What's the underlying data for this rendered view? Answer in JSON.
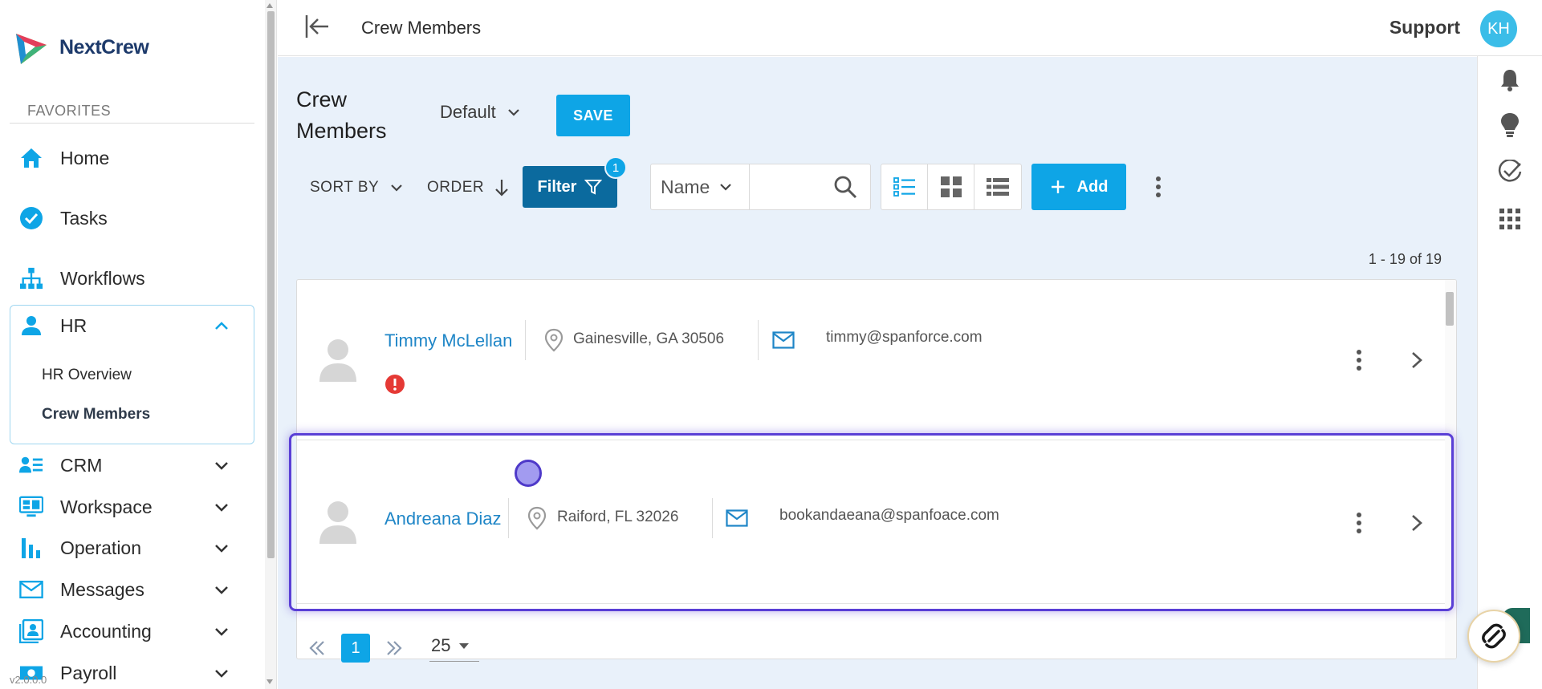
{
  "app": {
    "name": "NextCrew",
    "version": "v2.0.0.0"
  },
  "sidebar": {
    "favorites_label": "FAVORITES",
    "items": [
      {
        "label": "Home",
        "icon": "home-icon"
      },
      {
        "label": "Tasks",
        "icon": "check-circle-icon"
      },
      {
        "label": "Workflows",
        "icon": "sitemap-icon"
      },
      {
        "label": "HR",
        "icon": "person-icon",
        "expanded": true
      },
      {
        "label": "CRM",
        "icon": "contacts-icon"
      },
      {
        "label": "Workspace",
        "icon": "monitor-icon"
      },
      {
        "label": "Operation",
        "icon": "bar-chart-icon"
      },
      {
        "label": "Messages",
        "icon": "mail-icon"
      },
      {
        "label": "Accounting",
        "icon": "account-box-icon"
      },
      {
        "label": "Payroll",
        "icon": "money-icon"
      }
    ],
    "hr_subitems": [
      {
        "label": "HR Overview",
        "active": false
      },
      {
        "label": "Crew Members",
        "active": true
      }
    ]
  },
  "topbar": {
    "title": "Crew Members",
    "support_label": "Support",
    "avatar_initials": "KH"
  },
  "main": {
    "page_title": "Crew Members",
    "view_select": "Default",
    "save_label": "SAVE",
    "sort_by_label": "SORT BY",
    "order_label": "ORDER",
    "filter_label": "Filter",
    "filter_count": "1",
    "search_field": "Name",
    "search_value": "",
    "add_label": "Add",
    "count_text": "1 - 19 of 19"
  },
  "rows": [
    {
      "name": "Timmy McLellan",
      "location": "Gainesville, GA 30506",
      "email": "timmy@spanforce.com",
      "alert": true
    },
    {
      "name": "Andreana Diaz",
      "location": "Raiford, FL 32026",
      "email": "bookandaeana@spanfoace.com",
      "alert": false
    }
  ],
  "pager": {
    "current_page": "1",
    "page_size": "25"
  },
  "colors": {
    "accent": "#0ea5e6",
    "filter": "#0b6a9e",
    "link": "#1f86c7",
    "highlight": "#5a3fd6",
    "background": "#e9f1fa"
  }
}
